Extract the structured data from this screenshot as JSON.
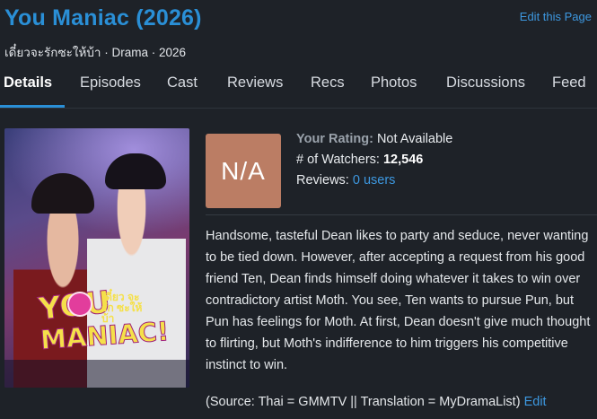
{
  "header": {
    "title": "You Maniac (2026)",
    "edit_page": "Edit this Page",
    "subtitle": "เดี๋ยวจะรักซะให้บ้า · Drama · 2026"
  },
  "tabs": [
    {
      "label": "Details",
      "active": true
    },
    {
      "label": "Episodes"
    },
    {
      "label": "Cast"
    },
    {
      "label": "Reviews"
    },
    {
      "label": "Recs"
    },
    {
      "label": "Photos"
    },
    {
      "label": "Discussions"
    },
    {
      "label": "Feed"
    }
  ],
  "poster": {
    "logo_line1": "YOU",
    "logo_line2": "MANIAC!",
    "logo_thai": "เดี๋ยว จะรัก ซะให้บ้า"
  },
  "rating": {
    "score": "N/A",
    "your_rating_label": "Your Rating:",
    "your_rating_value": "Not Available",
    "watchers_label": "# of Watchers:",
    "watchers_value": "12,546",
    "reviews_label": "Reviews:",
    "reviews_value": "0 users"
  },
  "synopsis": "Handsome, tasteful Dean likes to party and seduce, never wanting to be tied down. However, after accepting a request from his good friend Ten, Dean finds himself doing whatever it takes to win over contradictory artist Moth. You see, Ten wants to pursue Pun, but Pun has feelings for Moth. At first, Dean doesn't give much thought to flirting, but Moth's indifference to him triggers his competitive instinct to win.",
  "source": {
    "text": "(Source: Thai = GMMTV || Translation = MyDramaList)",
    "edit_link": "Edit"
  },
  "colors": {
    "accent": "#2a8fd6",
    "rating_box": "#bb7d64",
    "background": "#1e2228"
  }
}
